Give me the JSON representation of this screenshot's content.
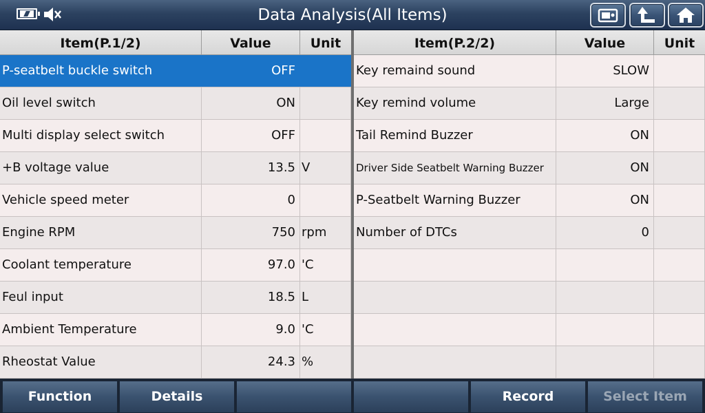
{
  "header": {
    "title": "Data Analysis(All Items)"
  },
  "left_table": {
    "headers": {
      "item": "Item(P.1/2)",
      "value": "Value",
      "unit": "Unit"
    },
    "rows": [
      {
        "item": "P-seatbelt buckle switch",
        "value": "OFF",
        "unit": ""
      },
      {
        "item": "Oil level switch",
        "value": "ON",
        "unit": ""
      },
      {
        "item": "Multi display select switch",
        "value": "OFF",
        "unit": ""
      },
      {
        "item": "+B voltage value",
        "value": "13.5",
        "unit": "V"
      },
      {
        "item": "Vehicle speed meter",
        "value": "0",
        "unit": ""
      },
      {
        "item": "Engine RPM",
        "value": "750",
        "unit": "rpm"
      },
      {
        "item": "Coolant temperature",
        "value": "97.0",
        "unit": "'C"
      },
      {
        "item": "Feul input",
        "value": "18.5",
        "unit": "L"
      },
      {
        "item": "Ambient Temperature",
        "value": "9.0",
        "unit": "'C"
      },
      {
        "item": "Rheostat Value",
        "value": "24.3",
        "unit": "%"
      }
    ]
  },
  "right_table": {
    "headers": {
      "item": "Item(P.2/2)",
      "value": "Value",
      "unit": "Unit"
    },
    "rows": [
      {
        "item": "Key remaind sound",
        "value": "SLOW",
        "unit": ""
      },
      {
        "item": "Key remind volume",
        "value": "Large",
        "unit": ""
      },
      {
        "item": "Tail Remind Buzzer",
        "value": "ON",
        "unit": ""
      },
      {
        "item": "Driver Side Seatbelt Warning Buzzer",
        "value": "ON",
        "unit": ""
      },
      {
        "item": "P-Seatbelt Warning Buzzer",
        "value": "ON",
        "unit": ""
      },
      {
        "item": "Number of DTCs",
        "value": "0",
        "unit": ""
      },
      {
        "item": "",
        "value": "",
        "unit": ""
      },
      {
        "item": "",
        "value": "",
        "unit": ""
      },
      {
        "item": "",
        "value": "",
        "unit": ""
      },
      {
        "item": "",
        "value": "",
        "unit": ""
      }
    ]
  },
  "bottom": {
    "function": "Function",
    "details": "Details",
    "blank1": "",
    "blank2": "",
    "record": "Record",
    "select_item": "Select Item"
  },
  "icons": {
    "battery": "battery-charging-icon",
    "speaker": "speaker-muted-icon",
    "screenshot": "screenshot-icon",
    "back": "back-arrow-icon",
    "home": "home-icon"
  },
  "colors": {
    "selected_row": "#1a74c8",
    "title_bar": "#2c4260"
  }
}
